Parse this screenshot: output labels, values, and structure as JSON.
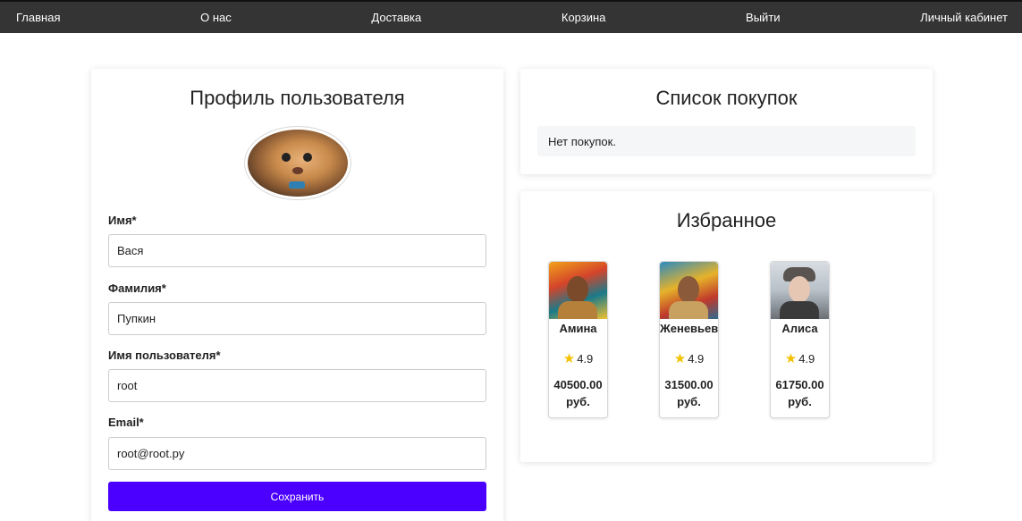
{
  "nav": {
    "items": [
      "Главная",
      "О нас",
      "Доставка",
      "Корзина",
      "Выйти",
      "Личный кабинет"
    ]
  },
  "profile": {
    "title": "Профиль пользователя",
    "fields": [
      {
        "label": "Имя*",
        "value": "Вася"
      },
      {
        "label": "Фамилия*",
        "value": "Пупкин"
      },
      {
        "label": "Имя пользователя*",
        "value": "root"
      },
      {
        "label": "Email*",
        "value": "root@root.py"
      }
    ],
    "save_label": "Сохранить"
  },
  "purchases": {
    "title": "Список покупок",
    "empty_text": "Нет покупок."
  },
  "favorites": {
    "title": "Избранное",
    "items": [
      {
        "name": "Амина",
        "rating": "4.9",
        "price": "40500.00",
        "currency": "руб."
      },
      {
        "name": "Женевьев",
        "rating": "4.9",
        "price": "31500.00",
        "currency": "руб."
      },
      {
        "name": "Алиса",
        "rating": "4.9",
        "price": "61750.00",
        "currency": "руб."
      }
    ]
  },
  "colors": {
    "nav_bg": "#343434",
    "accent": "#4b00ff",
    "star": "#f2c200"
  },
  "icons": {
    "rating": "star-icon"
  }
}
